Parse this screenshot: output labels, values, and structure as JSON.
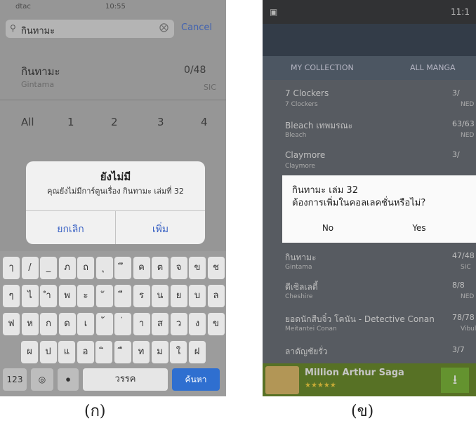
{
  "ios": {
    "status": {
      "carrier": "dtac",
      "time": "10:55"
    },
    "search": {
      "query": "กินทามะ",
      "cancel_label": "Cancel"
    },
    "result": {
      "title": "กินทามะ",
      "subtitle": "Gintama",
      "count": "0/48",
      "publisher": "SIC"
    },
    "volume_tabs": [
      "All",
      "1",
      "2",
      "3",
      "4"
    ],
    "alert": {
      "title": "ยังไม่มี",
      "message": "คุณยังไม่มีการ์ตูนเรื่อง กินทามะ เล่มที่ 32",
      "cancel_label": "ยกเลิก",
      "add_label": "เพิ่ม"
    },
    "keyboard": {
      "row1": [
        "ๅ",
        "/",
        "_",
        "ภ",
        "ถ",
        "ุ",
        "ึ",
        "ค",
        "ต",
        "จ",
        "ข",
        "ช"
      ],
      "row2": [
        "ๆ",
        "ไ",
        "ำ",
        "พ",
        "ะ",
        "ั",
        "ี",
        "ร",
        "น",
        "ย",
        "บ",
        "ล"
      ],
      "row3": [
        "ฟ",
        "ห",
        "ก",
        "ด",
        "เ",
        "้",
        "่",
        "า",
        "ส",
        "ว",
        "ง",
        "ข"
      ],
      "row4": [
        "ผ",
        "ป",
        "แ",
        "อ",
        "ิ",
        "ื",
        "ท",
        "ม",
        "ใ",
        "ฝ"
      ],
      "num_label": "123",
      "space_label": "วรรค",
      "search_label": "ค้นหา"
    }
  },
  "android": {
    "status": {
      "time": "11:1"
    },
    "tabs": [
      "MY COLLECTION",
      "ALL MANGA"
    ],
    "list": [
      {
        "name": "7 Clockers",
        "sub": "7 Clockers",
        "count": "3/",
        "pub": "NED"
      },
      {
        "name": "Bleach เทพมรณะ",
        "sub": "Bleach",
        "count": "63/63",
        "pub": "NED"
      },
      {
        "name": "Claymore",
        "sub": "Claymore",
        "count": "3/",
        "pub": ""
      },
      {
        "name": "กินทามะ",
        "sub": "Gintama",
        "count": "47/48",
        "pub": "SIC"
      },
      {
        "name": "ดีเซิลเลดี้",
        "sub": "Cheshire",
        "count": "8/8",
        "pub": "NED"
      },
      {
        "name": "ยอดนักสืบจิ๋ว โคนัน - Detective Conan",
        "sub": "Meitantei Conan",
        "count": "78/78",
        "pub": "Vibulkij"
      },
      {
        "name": "ลาดัญชัยรั่ว",
        "sub": "",
        "count": "3/7",
        "pub": ""
      }
    ],
    "dialog": {
      "line1": "กินทามะ เล่ม 32",
      "line2": "ต้องการเพิ่มในคอลเลคชั่นหรือไม่?",
      "no_label": "No",
      "yes_label": "Yes"
    },
    "ad": {
      "title": "Million Arthur Saga",
      "stars": "★★★★★",
      "download_glyph": "⭳"
    }
  },
  "captions": {
    "a": "(ก)",
    "b": "(ข)"
  }
}
